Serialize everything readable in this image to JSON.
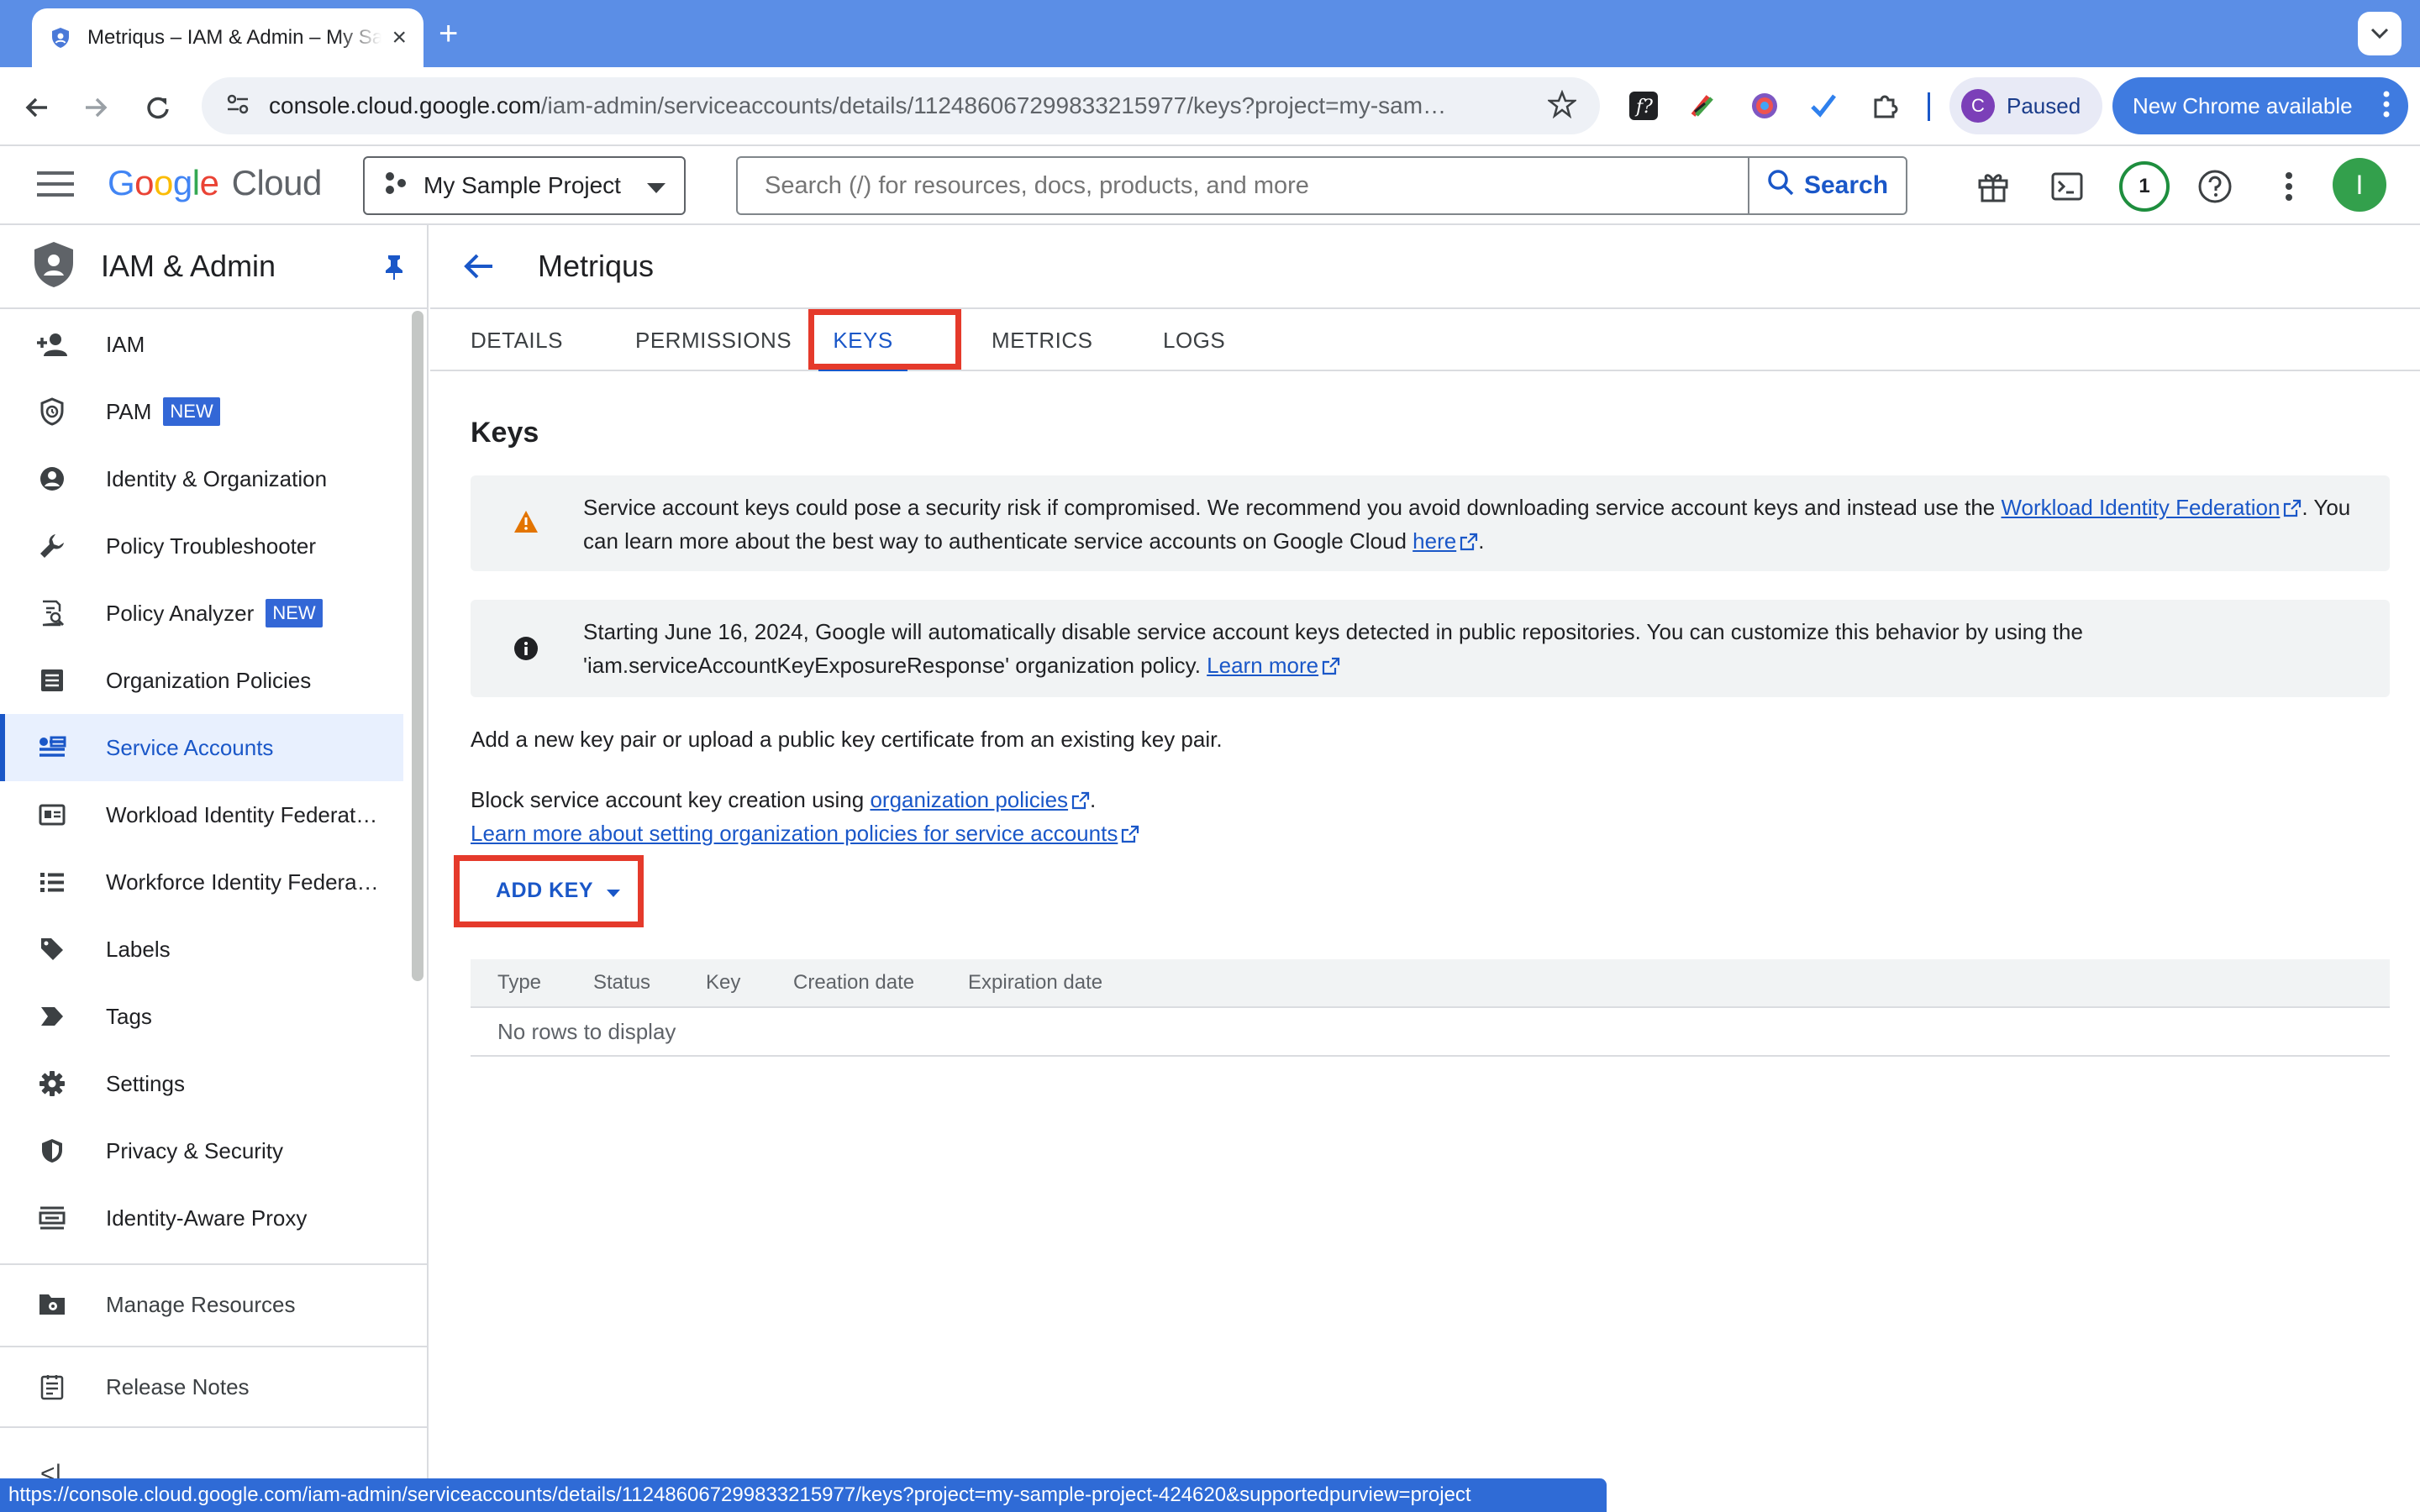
{
  "browser": {
    "tab_title": "Metriqus – IAM & Admin – My Sample Project",
    "url_host": "console.cloud.google.com",
    "url_path": "/iam-admin/serviceaccounts/details/112486067299833215977/keys?project=my-sam…",
    "profile_initial": "C",
    "profile_status": "Paused",
    "update_label": "New Chrome available",
    "status_url": "https://console.cloud.google.com/iam-admin/serviceaccounts/details/112486067299833215977/keys?project=my-sample-project-424620&supportedpurview=project"
  },
  "header": {
    "logo_google": "Google",
    "logo_cloud": "Cloud",
    "project": "My Sample Project",
    "search_placeholder": "Search (/) for resources, docs, products, and more",
    "search_button": "Search",
    "notification_count": "1",
    "user_initial": "I"
  },
  "sidebar": {
    "title": "IAM & Admin",
    "items": [
      {
        "label": "IAM",
        "icon": "person-add-icon"
      },
      {
        "label": "PAM",
        "badge": "NEW",
        "icon": "shield-clock-icon"
      },
      {
        "label": "Identity & Organization",
        "icon": "account-circle-icon"
      },
      {
        "label": "Policy Troubleshooter",
        "icon": "wrench-icon"
      },
      {
        "label": "Policy Analyzer",
        "badge": "NEW",
        "icon": "document-search-icon"
      },
      {
        "label": "Organization Policies",
        "icon": "list-document-icon"
      },
      {
        "label": "Service Accounts",
        "icon": "service-account-icon",
        "active": true
      },
      {
        "label": "Workload Identity Federat…",
        "icon": "id-card-icon"
      },
      {
        "label": "Workforce Identity Federa…",
        "icon": "list-icon"
      },
      {
        "label": "Labels",
        "icon": "label-icon"
      },
      {
        "label": "Tags",
        "icon": "tag-arrow-icon"
      },
      {
        "label": "Settings",
        "icon": "gear-icon"
      },
      {
        "label": "Privacy & Security",
        "icon": "shield-icon"
      },
      {
        "label": "Identity-Aware Proxy",
        "icon": "proxy-icon"
      }
    ],
    "manage_resources": "Manage Resources",
    "release_notes": "Release Notes",
    "collapse": "<|"
  },
  "page": {
    "title": "Metriqus",
    "tabs": [
      "DETAILS",
      "PERMISSIONS",
      "KEYS",
      "METRICS",
      "LOGS"
    ],
    "active_tab": "KEYS",
    "section_title": "Keys",
    "warning": {
      "text": "Service account keys could pose a security risk if compromised. We recommend you avoid downloading service account keys and instead use the ",
      "link1": "Workload Identity Federation",
      "text2": ". You can learn more about the best way to authenticate service accounts on Google Cloud ",
      "link2": "here",
      "text3": "."
    },
    "info": {
      "text": "Starting June 16, 2024, Google will automatically disable service account keys detected in public repositories. You can customize this behavior by using the 'iam.serviceAccountKeyExposureResponse' organization policy. ",
      "link": "Learn more"
    },
    "add_desc": "Add a new key pair or upload a public key certificate from an existing key pair.",
    "block_text": "Block service account key creation using ",
    "block_link": "organization policies",
    "block_end": ".",
    "learn_link": "Learn more about setting organization policies for service accounts",
    "add_key_button": "ADD KEY",
    "table": {
      "columns": [
        "Type",
        "Status",
        "Key",
        "Creation date",
        "Expiration date"
      ],
      "empty": "No rows to display"
    }
  },
  "colors": {
    "chrome_blue": "#5b8ee6",
    "accent": "#1a57c8",
    "highlight_red": "#e53a2b",
    "warning_orange": "#e37400"
  }
}
